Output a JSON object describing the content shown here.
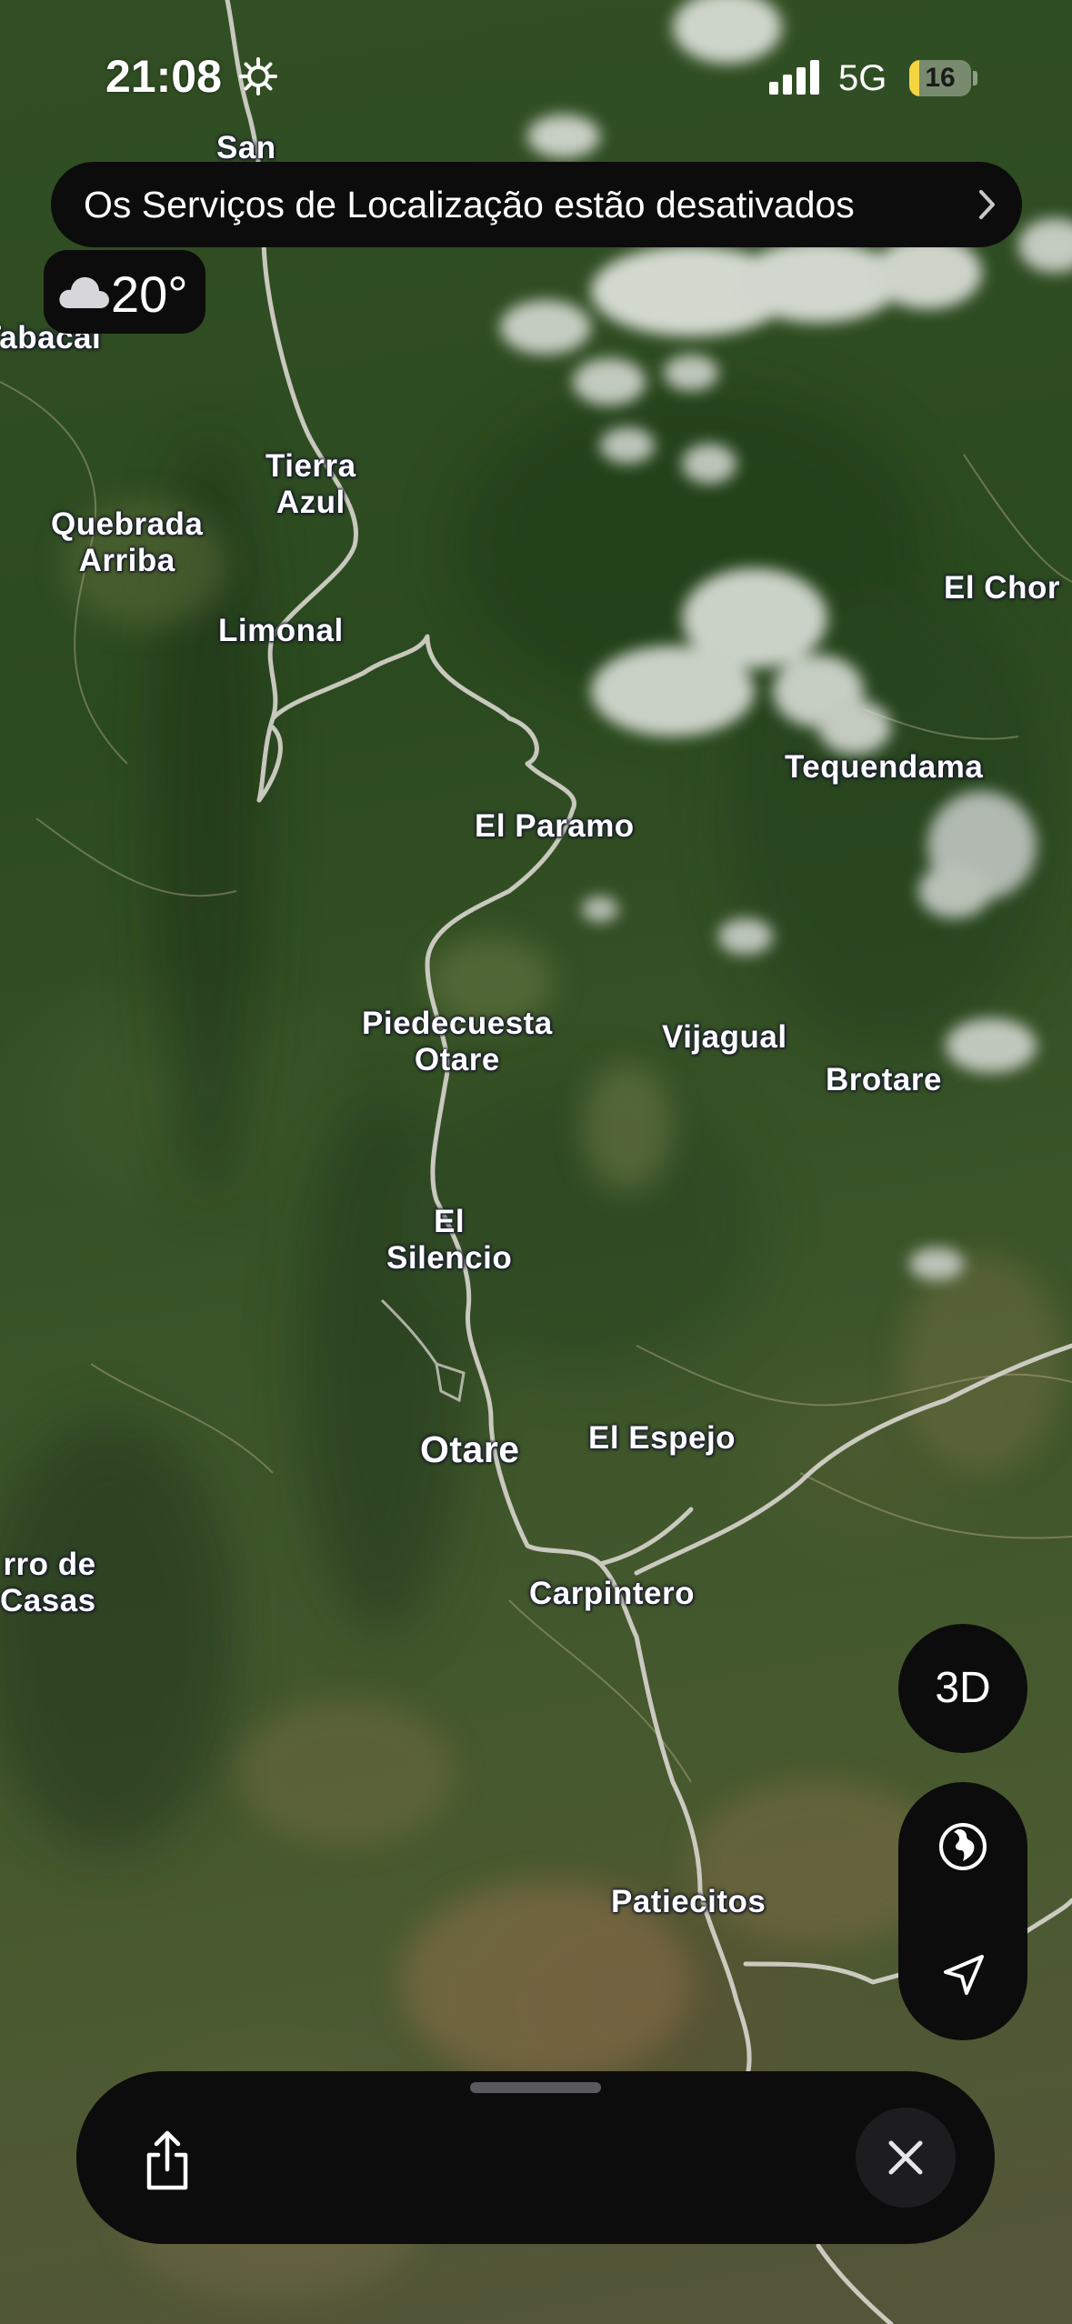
{
  "status_bar": {
    "time": "21:08",
    "network": "5G",
    "battery_level": "16",
    "battery_fraction": 0.16,
    "icons": [
      "gear-icon",
      "cellular-signal-icon",
      "battery-icon"
    ]
  },
  "location_banner": {
    "text": "Os Serviços de Localização estão desativados",
    "icon": "chevron-right-icon"
  },
  "weather": {
    "icon": "cloud-icon",
    "temperature": "20°"
  },
  "map": {
    "type": "satellite",
    "places": [
      {
        "id": "san",
        "label": "San"
      },
      {
        "id": "tabacal",
        "label": "Tabacal"
      },
      {
        "id": "tierra-azul",
        "label": "Tierra\nAzul"
      },
      {
        "id": "quebrada-arriba",
        "label": "Quebrada\nArriba"
      },
      {
        "id": "limonal",
        "label": "Limonal"
      },
      {
        "id": "el-chor",
        "label": "El Chor"
      },
      {
        "id": "tequendama",
        "label": "Tequendama"
      },
      {
        "id": "el-paramo",
        "label": "El Paramo"
      },
      {
        "id": "piedecuesta-otare",
        "label": "Piedecuesta\nOtare"
      },
      {
        "id": "vijagual",
        "label": "Vijagual"
      },
      {
        "id": "brotare",
        "label": "Brotare"
      },
      {
        "id": "el-silencio",
        "label": "El\nSilencio"
      },
      {
        "id": "otare",
        "label": "Otare"
      },
      {
        "id": "el-espejo",
        "label": "El Espejo"
      },
      {
        "id": "cerro-de-casas",
        "label": "rro de\nCasas"
      },
      {
        "id": "carpintero",
        "label": "Carpintero"
      },
      {
        "id": "patiecitos",
        "label": "Patiecitos"
      }
    ]
  },
  "controls": {
    "view_3d_label": "3D",
    "globe_icon": "globe-icon",
    "location_icon": "location-arrow-icon"
  },
  "bottom_sheet": {
    "share_icon": "share-icon",
    "close_icon": "close-icon"
  },
  "colors": {
    "panel": "#0c0c0c",
    "battery": "#f5d442",
    "road": "#d9d6cf",
    "label_halo": "#1a1d2e"
  }
}
